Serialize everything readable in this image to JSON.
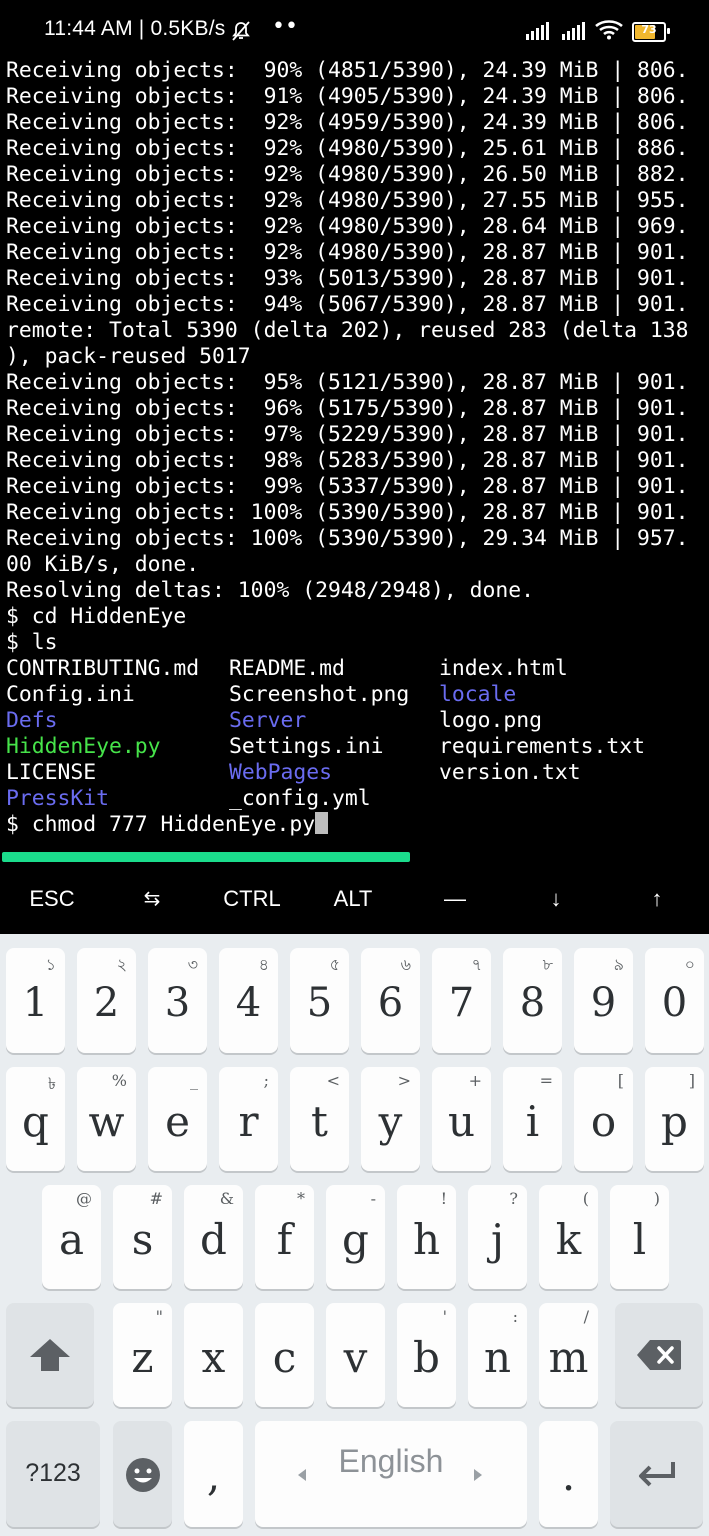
{
  "status_bar": {
    "time": "11:44 AM | 0.5KB/s",
    "dots": "••",
    "battery_level": "73"
  },
  "terminal": {
    "lines": [
      "Receiving objects:  90% (4851/5390), 24.39 MiB | 806.",
      "Receiving objects:  91% (4905/5390), 24.39 MiB | 806.",
      "Receiving objects:  92% (4959/5390), 24.39 MiB | 806.",
      "Receiving objects:  92% (4980/5390), 25.61 MiB | 886.",
      "Receiving objects:  92% (4980/5390), 26.50 MiB | 882.",
      "Receiving objects:  92% (4980/5390), 27.55 MiB | 955.",
      "Receiving objects:  92% (4980/5390), 28.64 MiB | 969.",
      "Receiving objects:  92% (4980/5390), 28.87 MiB | 901.",
      "Receiving objects:  93% (5013/5390), 28.87 MiB | 901.",
      "Receiving objects:  94% (5067/5390), 28.87 MiB | 901.",
      "remote: Total 5390 (delta 202), reused 283 (delta 138",
      "), pack-reused 5017",
      "Receiving objects:  95% (5121/5390), 28.87 MiB | 901.",
      "Receiving objects:  96% (5175/5390), 28.87 MiB | 901.",
      "Receiving objects:  97% (5229/5390), 28.87 MiB | 901.",
      "Receiving objects:  98% (5283/5390), 28.87 MiB | 901.",
      "Receiving objects:  99% (5337/5390), 28.87 MiB | 901.",
      "Receiving objects: 100% (5390/5390), 28.87 MiB | 901.",
      "Receiving objects: 100% (5390/5390), 29.34 MiB | 957.",
      "00 KiB/s, done.",
      "Resolving deltas: 100% (2948/2948), done.",
      "$ cd HiddenEye",
      "$ ls"
    ],
    "ls_rows": [
      [
        "CONTRIBUTING.md",
        "README.md",
        "index.html"
      ],
      [
        "Config.ini",
        "Screenshot.png",
        "locale"
      ],
      [
        "Defs",
        "Server",
        "logo.png"
      ],
      [
        "HiddenEye.py",
        "Settings.ini",
        "requirements.txt"
      ],
      [
        "LICENSE",
        "WebPages",
        "version.txt"
      ],
      [
        "PressKit",
        "_config.yml",
        ""
      ]
    ],
    "prompt": "$ chmod 777 HiddenEye.py",
    "colors": {
      "background": "#000000",
      "text": "#ffffff",
      "directory": "#6a6cf0",
      "executable": "#46e34a",
      "scrollbar": "#1bdc8c"
    }
  },
  "extra_keys": [
    "ESC",
    "⇆",
    "CTRL",
    "ALT",
    "—",
    "↓",
    "↑"
  ],
  "keyboard": {
    "row1": [
      {
        "key": "1",
        "hint": "১"
      },
      {
        "key": "2",
        "hint": "২"
      },
      {
        "key": "3",
        "hint": "৩"
      },
      {
        "key": "4",
        "hint": "৪"
      },
      {
        "key": "5",
        "hint": "৫"
      },
      {
        "key": "6",
        "hint": "৬"
      },
      {
        "key": "7",
        "hint": "৭"
      },
      {
        "key": "8",
        "hint": "৮"
      },
      {
        "key": "9",
        "hint": "৯"
      },
      {
        "key": "0",
        "hint": "০"
      }
    ],
    "row2": [
      {
        "key": "q",
        "hint": "৳"
      },
      {
        "key": "w",
        "hint": "%"
      },
      {
        "key": "e",
        "hint": "_"
      },
      {
        "key": "r",
        "hint": ";"
      },
      {
        "key": "t",
        "hint": "<"
      },
      {
        "key": "y",
        "hint": ">"
      },
      {
        "key": "u",
        "hint": "+"
      },
      {
        "key": "i",
        "hint": "="
      },
      {
        "key": "o",
        "hint": "["
      },
      {
        "key": "p",
        "hint": "]"
      }
    ],
    "row3": [
      {
        "key": "a",
        "hint": "@"
      },
      {
        "key": "s",
        "hint": "#"
      },
      {
        "key": "d",
        "hint": "&"
      },
      {
        "key": "f",
        "hint": "*"
      },
      {
        "key": "g",
        "hint": "-"
      },
      {
        "key": "h",
        "hint": "!"
      },
      {
        "key": "j",
        "hint": "?"
      },
      {
        "key": "k",
        "hint": "("
      },
      {
        "key": "l",
        "hint": ")"
      }
    ],
    "row4": [
      {
        "key": "z",
        "hint": "\""
      },
      {
        "key": "x",
        "hint": ""
      },
      {
        "key": "c",
        "hint": ""
      },
      {
        "key": "v",
        "hint": ""
      },
      {
        "key": "b",
        "hint": "'"
      },
      {
        "key": "n",
        "hint": ":"
      },
      {
        "key": "m",
        "hint": "/"
      }
    ],
    "symbols_label": "?123",
    "comma": ",",
    "space_label": "English",
    "period": "."
  }
}
